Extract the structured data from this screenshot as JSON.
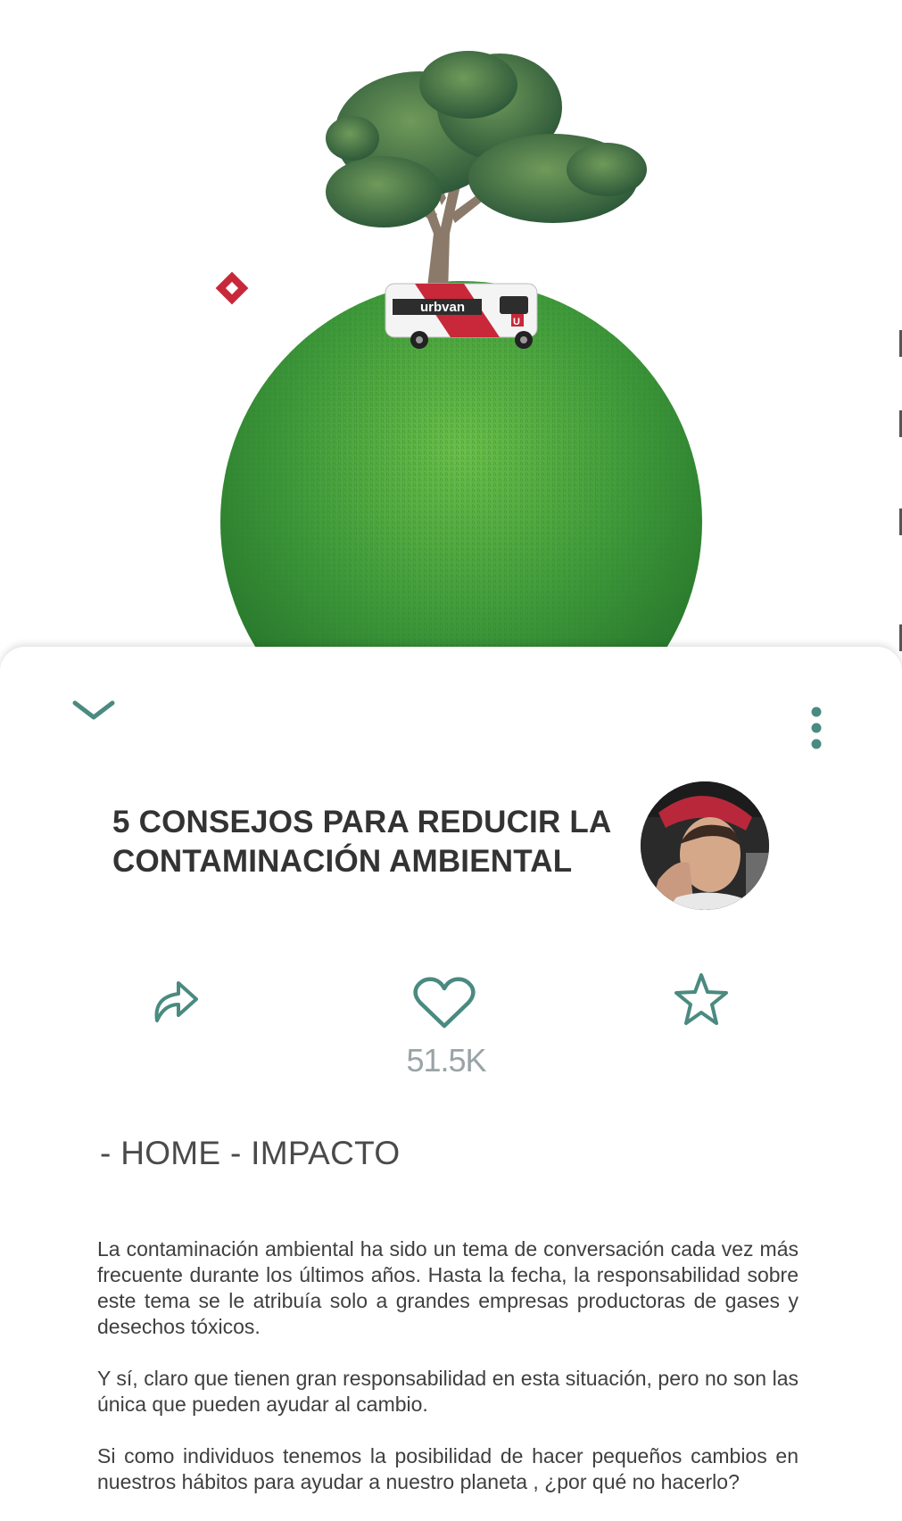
{
  "hero": {
    "van_brand": "urbvan",
    "van_badge": "U"
  },
  "colors": {
    "accent": "#4a8a80",
    "grass": "#3f9a3a",
    "brand_red": "#c8283a"
  },
  "sheet": {
    "collapse_icon": "chevron-down-icon",
    "menu_icon": "more-vertical-icon"
  },
  "article": {
    "title": "5 CONSEJOS PARA REDUCIR LA CONTAMINACIÓN AMBIENTAL",
    "author_avatar": "avatar"
  },
  "actions": {
    "share_icon": "share-icon",
    "like_icon": "heart-icon",
    "like_count": "51.5K",
    "favorite_icon": "star-icon"
  },
  "breadcrumb": "- HOME - IMPACTO",
  "body": {
    "paragraphs": [
      "La contaminación ambiental ha sido un tema de conversación cada vez más frecuente durante los últimos años. Hasta la fecha, la responsabilidad sobre este tema se le atribuía solo a grandes empresas productoras de gases y desechos tóxicos.",
      "Y sí, claro que tienen gran responsabilidad en esta situación, pero no son las única que pueden ayudar al cambio.",
      "Si como individuos tenemos la posibilidad de hacer pequeños cambios en nuestros hábitos para ayudar a nuestro planeta , ¿por qué no hacerlo?"
    ]
  }
}
